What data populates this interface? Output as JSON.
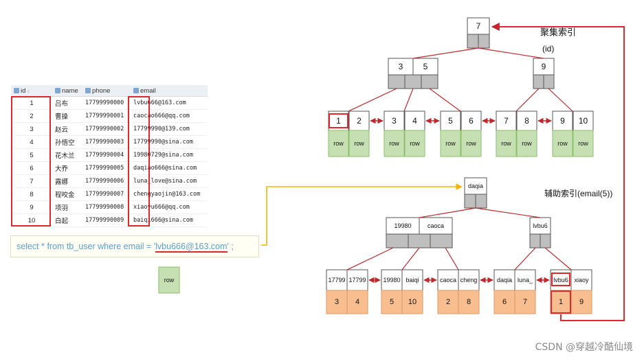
{
  "table": {
    "headers": [
      {
        "key": "id",
        "label": "id"
      },
      {
        "key": "name",
        "label": "name"
      },
      {
        "key": "phone",
        "label": "phone"
      },
      {
        "key": "email",
        "label": "email"
      }
    ],
    "rows": [
      {
        "id": "1",
        "name": "吕布",
        "phone": "17799990000",
        "email": "lvbu666@163.com"
      },
      {
        "id": "2",
        "name": "曹操",
        "phone": "17799990001",
        "email": "caocao666@qq.com"
      },
      {
        "id": "3",
        "name": "赵云",
        "phone": "17799990002",
        "email": "17799990@139.com"
      },
      {
        "id": "4",
        "name": "孙悟空",
        "phone": "17799990003",
        "email": "17799990@sina.com"
      },
      {
        "id": "5",
        "name": "花木兰",
        "phone": "17799990004",
        "email": "19980729@sina.com"
      },
      {
        "id": "6",
        "name": "大乔",
        "phone": "17799990005",
        "email": "daqiao666@sina.com"
      },
      {
        "id": "7",
        "name": "露娜",
        "phone": "17799990006",
        "email": "luna_love@sina.com"
      },
      {
        "id": "8",
        "name": "程咬金",
        "phone": "17799990007",
        "email": "chengyaojin@163.com"
      },
      {
        "id": "9",
        "name": "项羽",
        "phone": "17799990008",
        "email": "xiaoyu666@qq.com"
      },
      {
        "id": "10",
        "name": "白起",
        "phone": "17799990009",
        "email": "baiqi666@sina.com"
      }
    ]
  },
  "sql": {
    "prefix": "select * from tb_user where email = '",
    "value": "lvbu666@163.com",
    "suffix": "' ;"
  },
  "row_label": "row",
  "clustered_index": {
    "title": "聚集索引",
    "subtitle": "(id)",
    "root": [
      "7"
    ],
    "internal": [
      [
        "3",
        "5"
      ],
      [
        "9"
      ]
    ],
    "leaves": [
      [
        "1",
        "2"
      ],
      [
        "3",
        "4"
      ],
      [
        "5",
        "6"
      ],
      [
        "7",
        "8"
      ],
      [
        "9",
        "10"
      ]
    ],
    "leaf_payload": "row"
  },
  "secondary_index": {
    "title": "辅助索引(email(5))",
    "root": [
      "daqia"
    ],
    "internal": [
      [
        "19980",
        "caoca"
      ],
      [
        "lvbu6"
      ]
    ],
    "leaves": [
      [
        "17799",
        "17799"
      ],
      [
        "19980",
        "baiqi"
      ],
      [
        "caoca",
        "cheng"
      ],
      [
        "daqia",
        "luna_"
      ],
      [
        "lvbu6",
        "xiaoy"
      ]
    ],
    "leaf_ids": [
      [
        "3",
        "4"
      ],
      [
        "5",
        "10"
      ],
      [
        "2",
        "8"
      ],
      [
        "6",
        "7"
      ],
      [
        "1",
        "9"
      ]
    ]
  },
  "colors": {
    "arrow_red": "#c0282c",
    "highlight_red": "#e0282c",
    "arrow_orange": "#f5b400",
    "node_gray": "#bfbfbf",
    "row_green": "#c6e0b4",
    "id_orange": "#f8be8f",
    "sql_text": "#5a9fd0"
  },
  "watermark": "CSDN @穿越冷酷仙境"
}
